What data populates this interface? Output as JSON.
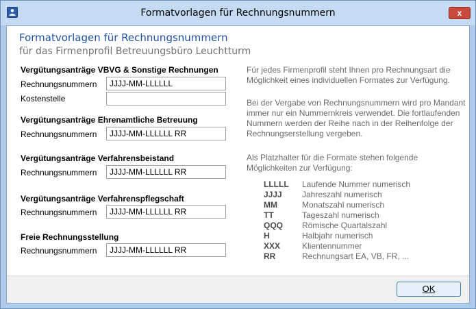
{
  "window": {
    "title": "Formatvorlagen für Rechnungsnummern",
    "close_label": "x"
  },
  "header": {
    "title": "Formatvorlagen für Rechnungsnummern",
    "subtitle": "für das Firmenprofil Betreuungsbüro Leuchtturm"
  },
  "sections": {
    "vbvg": {
      "title": "Vergütungsanträge VBVG & Sonstige Rechnungen",
      "rechnungsnummern_label": "Rechnungsnummern",
      "rechnungsnummern_value": "JJJJ-MM-LLLLLL",
      "kostenstelle_label": "Kostenstelle",
      "kostenstelle_value": ""
    },
    "ehrenamtlich": {
      "title": "Vergütungsanträge Ehrenamtliche Betreuung",
      "rechnungsnummern_label": "Rechnungsnummern",
      "rechnungsnummern_value": "JJJJ-MM-LLLLLL RR"
    },
    "verfahrensbeistand": {
      "title": "Vergütungsanträge Verfahrensbeistand",
      "rechnungsnummern_label": "Rechnungsnummern",
      "rechnungsnummern_value": "JJJJ-MM-LLLLLL RR"
    },
    "verfahrenspflegschaft": {
      "title": "Vergütungsanträge Verfahrenspflegschaft",
      "rechnungsnummern_label": "Rechnungsnummern",
      "rechnungsnummern_value": "JJJJ-MM-LLLLLL RR"
    },
    "freie": {
      "title": "Freie Rechnungsstellung",
      "rechnungsnummern_label": "Rechnungsnummern",
      "rechnungsnummern_value": "JJJJ-MM-LLLLLL RR"
    }
  },
  "info": {
    "paragraph1": "Für jedes Firmenprofil steht Ihnen pro Rechnungsart die Möglichkeit eines individuellen Formates zur Verfügung.",
    "paragraph2": "Bei der Vergabe von Rechnungsnummern wird pro Mandant immer nur ein Nummernkreis verwendet. Die fortlaufenden Nummern werden der Reihe nach in der Reihenfolge der Rechnungserstellung vergeben.",
    "paragraph3": "Als Platzhalter für die Formate stehen folgende Möglichkeiten zur Verfügung:",
    "placeholders": [
      {
        "code": "LLLLL",
        "desc": "Laufende Nummer numerisch"
      },
      {
        "code": "JJJJ",
        "desc": "Jahreszahl numerisch"
      },
      {
        "code": "MM",
        "desc": "Monatszahl numerisch"
      },
      {
        "code": "TT",
        "desc": "Tageszahl numerisch"
      },
      {
        "code": "QQQ",
        "desc": "Römische Quartalszahl"
      },
      {
        "code": "H",
        "desc": "Halbjahr numerisch"
      },
      {
        "code": "XXX",
        "desc": "Klientennummer"
      },
      {
        "code": "RR",
        "desc": "Rechnungsart EA, VB, FR, ..."
      }
    ]
  },
  "footer": {
    "ok_label": "OK"
  }
}
